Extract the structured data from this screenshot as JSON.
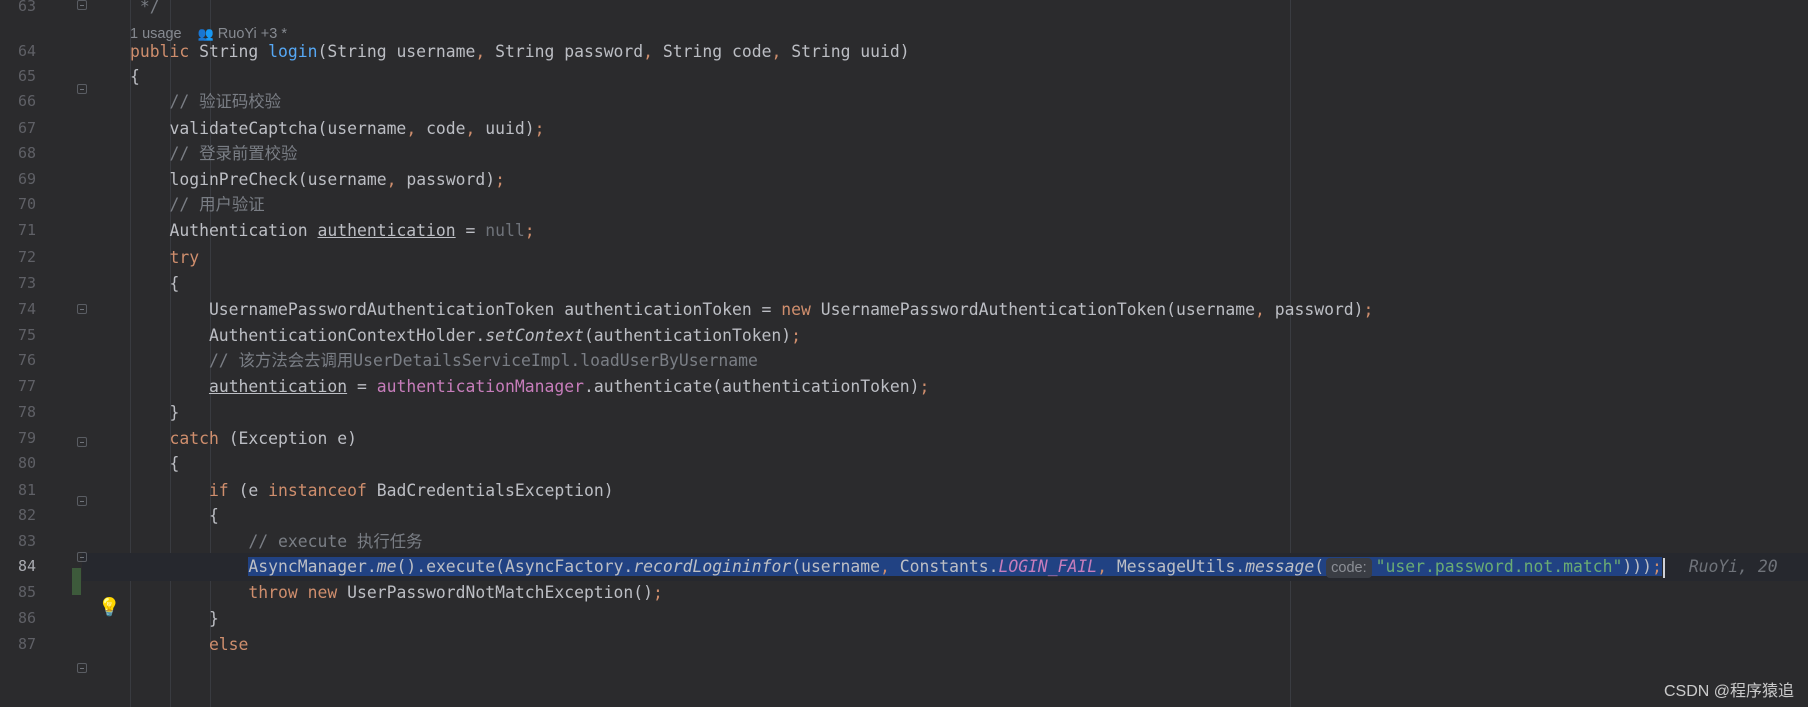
{
  "codelens": {
    "usages": "1 usage",
    "authors": "RuoYi +3 *"
  },
  "lines": [
    {
      "n": "63",
      "segments": [
        {
          "t": " */",
          "c": "cm"
        }
      ]
    },
    {
      "n": "64",
      "segments": [
        {
          "t": "public ",
          "c": "kw"
        },
        {
          "t": "String ",
          "c": ""
        },
        {
          "t": "login",
          "c": "fn"
        },
        {
          "t": "(String username",
          "c": ""
        },
        {
          "t": ", ",
          "c": "kw"
        },
        {
          "t": "String password",
          "c": ""
        },
        {
          "t": ", ",
          "c": "kw"
        },
        {
          "t": "String code",
          "c": ""
        },
        {
          "t": ", ",
          "c": "kw"
        },
        {
          "t": "String uuid)",
          "c": ""
        }
      ]
    },
    {
      "n": "65",
      "segments": [
        {
          "t": "{",
          "c": ""
        }
      ]
    },
    {
      "n": "66",
      "segments": [
        {
          "t": "    // 验证码校验",
          "c": "cm"
        }
      ]
    },
    {
      "n": "67",
      "segments": [
        {
          "t": "    validateCaptcha(username",
          "c": ""
        },
        {
          "t": ", ",
          "c": "kw"
        },
        {
          "t": "code",
          "c": ""
        },
        {
          "t": ", ",
          "c": "kw"
        },
        {
          "t": "uuid)",
          "c": ""
        },
        {
          "t": ";",
          "c": "kw"
        }
      ]
    },
    {
      "n": "68",
      "segments": [
        {
          "t": "    // 登录前置校验",
          "c": "cm"
        }
      ]
    },
    {
      "n": "69",
      "segments": [
        {
          "t": "    loginPreCheck(username",
          "c": ""
        },
        {
          "t": ", ",
          "c": "kw"
        },
        {
          "t": "password)",
          "c": ""
        },
        {
          "t": ";",
          "c": "kw"
        }
      ]
    },
    {
      "n": "70",
      "segments": [
        {
          "t": "    // 用户验证",
          "c": "cm"
        }
      ]
    },
    {
      "n": "71",
      "segments": [
        {
          "t": "    Authentication ",
          "c": ""
        },
        {
          "t": "authentication",
          "c": "under"
        },
        {
          "t": " = ",
          "c": ""
        },
        {
          "t": "null",
          "c": "nullkw"
        },
        {
          "t": ";",
          "c": "kw"
        }
      ]
    },
    {
      "n": "72",
      "segments": [
        {
          "t": "    try",
          "c": "kw"
        }
      ]
    },
    {
      "n": "73",
      "segments": [
        {
          "t": "    {",
          "c": ""
        }
      ]
    },
    {
      "n": "74",
      "segments": [
        {
          "t": "        UsernamePasswordAuthenticationToken authenticationToken = ",
          "c": ""
        },
        {
          "t": "new ",
          "c": "kw"
        },
        {
          "t": "UsernamePasswordAuthenticationToken(username",
          "c": ""
        },
        {
          "t": ", ",
          "c": "kw"
        },
        {
          "t": "password)",
          "c": ""
        },
        {
          "t": ";",
          "c": "kw"
        }
      ]
    },
    {
      "n": "75",
      "segments": [
        {
          "t": "        AuthenticationContextHolder.",
          "c": ""
        },
        {
          "t": "setContext",
          "c": "italic"
        },
        {
          "t": "(authenticationToken)",
          "c": ""
        },
        {
          "t": ";",
          "c": "kw"
        }
      ]
    },
    {
      "n": "76",
      "segments": [
        {
          "t": "        // 该方法会去调用UserDetailsServiceImpl.loadUserByUsername",
          "c": "cm"
        }
      ]
    },
    {
      "n": "77",
      "segments": [
        {
          "t": "        ",
          "c": ""
        },
        {
          "t": "authentication",
          "c": "under"
        },
        {
          "t": " = ",
          "c": ""
        },
        {
          "t": "authenticationManager",
          "c": "fld"
        },
        {
          "t": ".authenticate(authenticationToken)",
          "c": ""
        },
        {
          "t": ";",
          "c": "kw"
        }
      ]
    },
    {
      "n": "78",
      "segments": [
        {
          "t": "    }",
          "c": ""
        }
      ]
    },
    {
      "n": "79",
      "segments": [
        {
          "t": "    catch ",
          "c": "kw"
        },
        {
          "t": "(Exception e)",
          "c": ""
        }
      ]
    },
    {
      "n": "80",
      "segments": [
        {
          "t": "    {",
          "c": ""
        }
      ]
    },
    {
      "n": "81",
      "segments": [
        {
          "t": "        if ",
          "c": "kw"
        },
        {
          "t": "(e ",
          "c": ""
        },
        {
          "t": "instanceof ",
          "c": "kw"
        },
        {
          "t": "BadCredentialsException)",
          "c": ""
        }
      ]
    },
    {
      "n": "82",
      "segments": [
        {
          "t": "        {",
          "c": ""
        }
      ]
    },
    {
      "n": "83",
      "segments": [
        {
          "t": "            // execute 执行任务",
          "c": "cm"
        }
      ]
    },
    {
      "n": "84",
      "current": true
    },
    {
      "n": "85",
      "segments": [
        {
          "t": "            throw ",
          "c": "kw"
        },
        {
          "t": "new ",
          "c": "kw"
        },
        {
          "t": "UserPasswordNotMatchException()",
          "c": ""
        },
        {
          "t": ";",
          "c": "kw"
        }
      ]
    },
    {
      "n": "86",
      "segments": [
        {
          "t": "        }",
          "c": ""
        }
      ]
    },
    {
      "n": "87",
      "segments": [
        {
          "t": "        else",
          "c": "kw"
        }
      ]
    }
  ],
  "line84": {
    "indent": "            ",
    "p1": "AsyncManager.",
    "p2": "me",
    "p3": "().execute(AsyncFactory.",
    "p4": "recordLogininfor",
    "p5": "(username",
    "p6": ", ",
    "p7": "Constants.",
    "p8": "LOGIN_FAIL",
    "p9": ", ",
    "p10": "MessageUtils.",
    "p11": "message",
    "p12": "(",
    "hint": "code:",
    "p13": "\"user.password.not.match\"",
    "p14": ")))",
    "p15": ";",
    "blame": "RuoYi, 20"
  },
  "watermark": "CSDN @程序猿追"
}
